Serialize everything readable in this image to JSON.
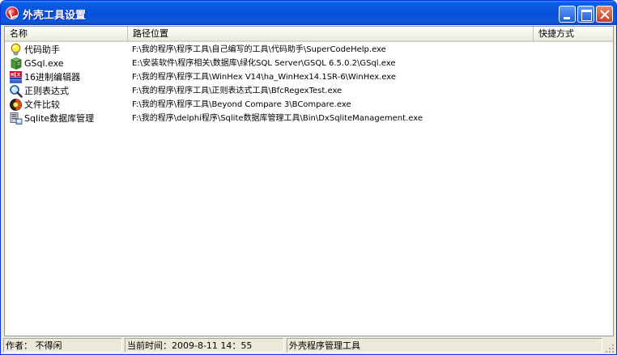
{
  "window": {
    "title": "外壳工具设置"
  },
  "columns": {
    "name": "名称",
    "path": "路径位置",
    "shortcut": "快捷方式"
  },
  "rows": [
    {
      "name": "代码助手",
      "path": "F:\\我的程序\\程序工具\\自己编写的工具\\代码助手\\SuperCodeHelp.exe",
      "icon": "lightbulb-icon"
    },
    {
      "name": "GSql.exe",
      "path": "E:\\安装软件\\程序相关\\数据库\\绿化SQL Server\\GSQL 6.5.0.2\\GSql.exe",
      "icon": "database-book-icon"
    },
    {
      "name": "16进制编辑器",
      "path": "F:\\我的程序\\程序工具\\WinHex V14\\ha_WinHex14.1SR-6\\WinHex.exe",
      "icon": "hex-editor-icon"
    },
    {
      "name": "正则表达式",
      "path": "F:\\我的程序\\程序工具\\正则表达式工具\\BfcRegexTest.exe",
      "icon": "magnifier-icon"
    },
    {
      "name": "文件比较",
      "path": "F:\\我的程序\\程序工具\\Beyond Compare 3\\BCompare.exe",
      "icon": "compare-icon"
    },
    {
      "name": "Sqlite数据库管理",
      "path": "F:\\我的程序\\delphi程序\\Sqlite数据库管理工具\\Bin\\DxSqliteManagement.exe",
      "icon": "server-icon"
    }
  ],
  "status": {
    "author": "作者：  不得闲",
    "time": "当前时间：2009-8-11   14：55",
    "app": "外壳程序管理工具"
  }
}
